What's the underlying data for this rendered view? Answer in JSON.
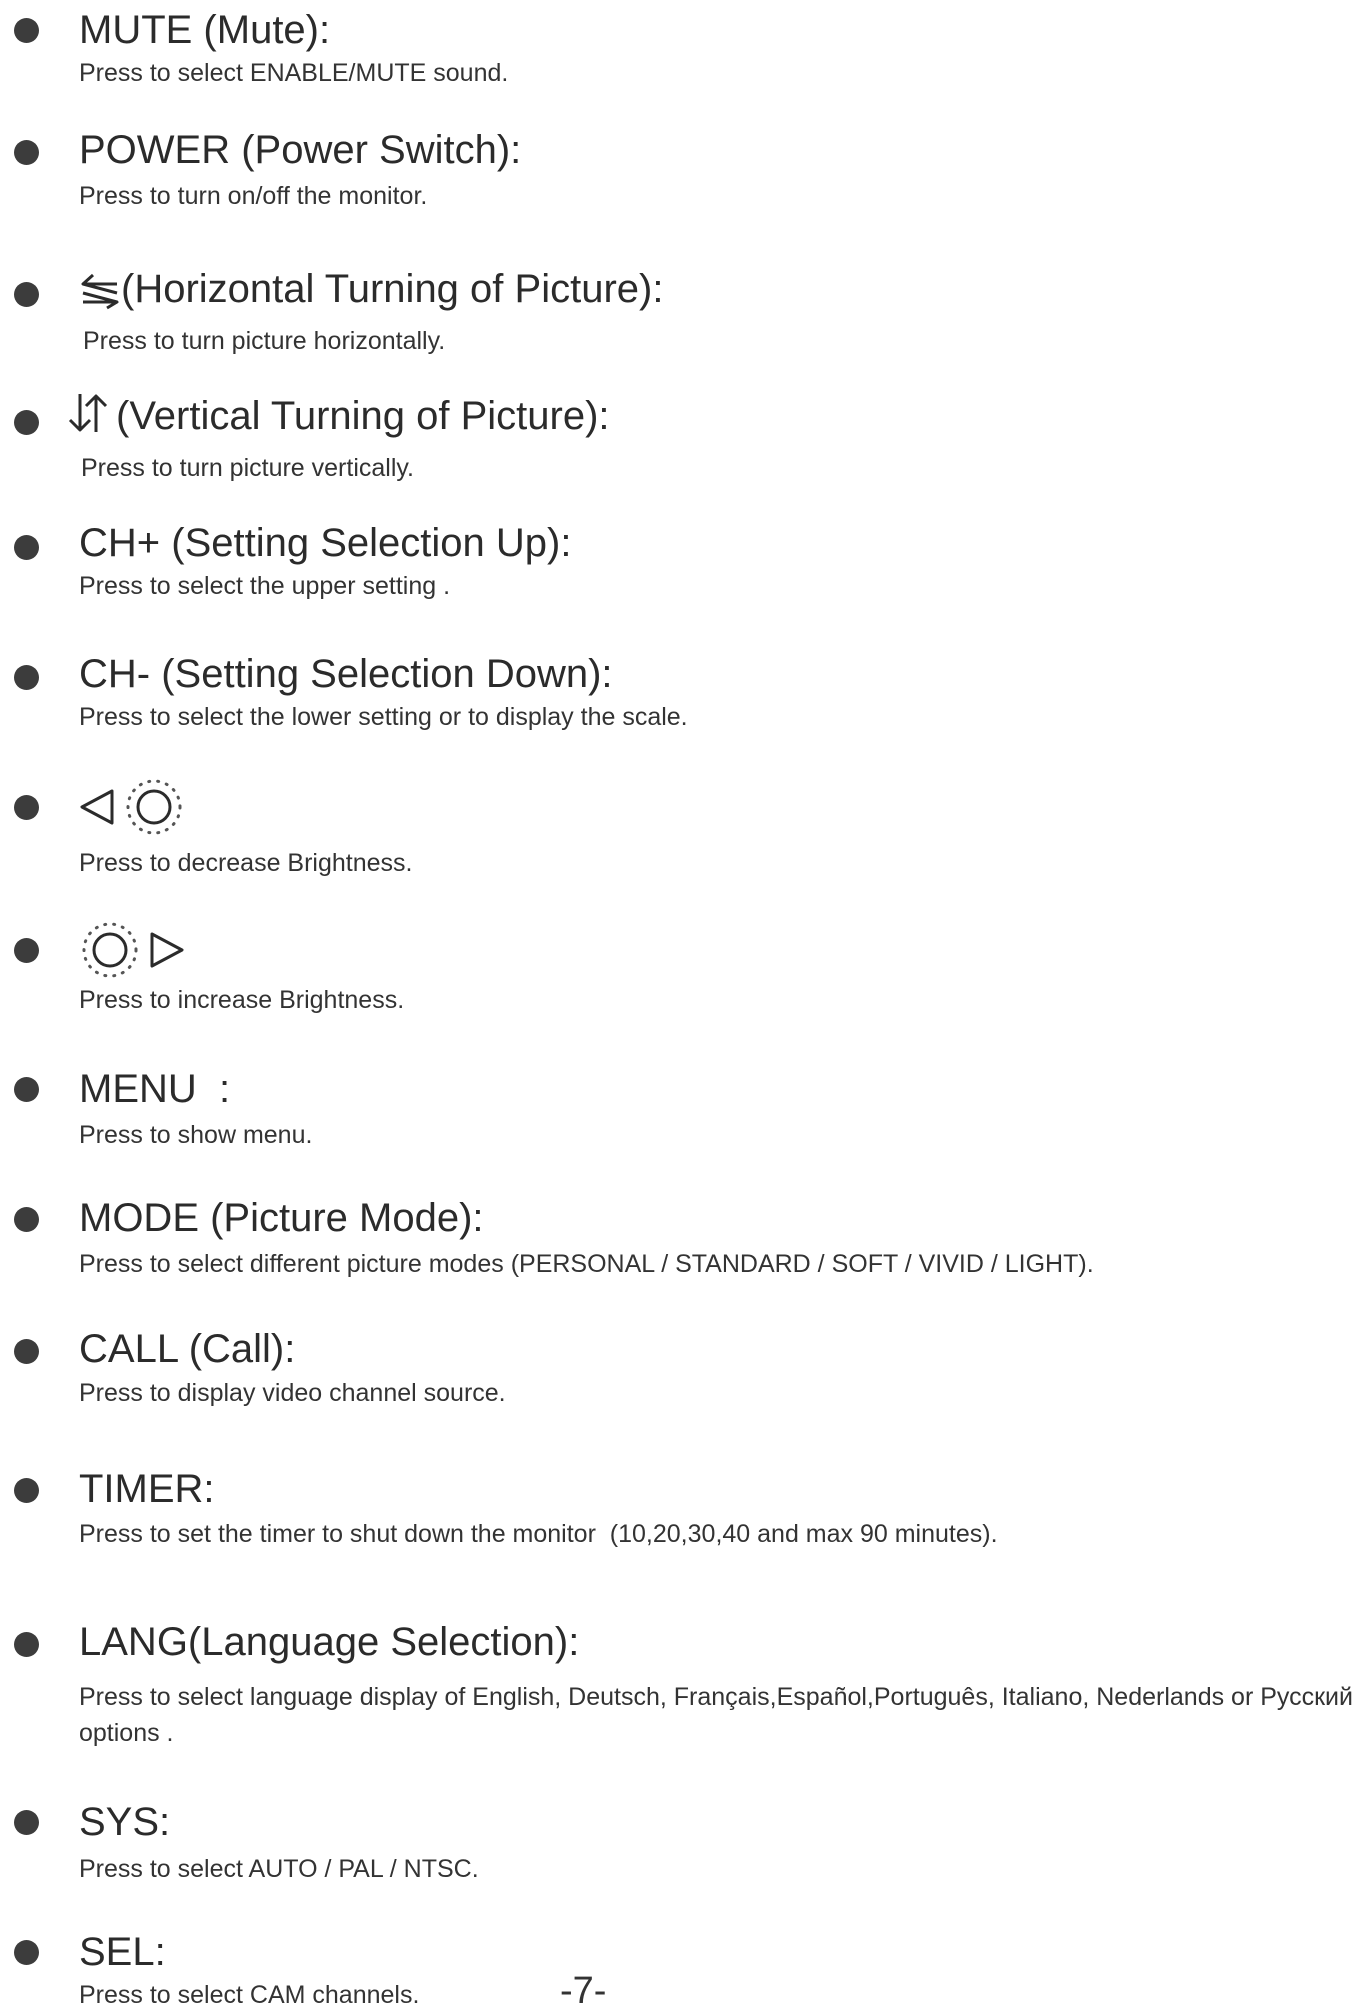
{
  "items": [
    {
      "title": "MUTE (Mute):",
      "desc": "Press to select  ENABLE/MUTE sound."
    },
    {
      "title": "POWER (Power Switch):",
      "desc": "Press to turn on/off the monitor."
    },
    {
      "title": "(Horizontal Turning of Picture):",
      "desc": "Press  to turn picture horizontally.",
      "icon": "horizontal-flip-icon"
    },
    {
      "title": "(Vertical  Turning of Picture):",
      "desc": "Press to turn picture vertically.",
      "icon": "vertical-flip-icon"
    },
    {
      "title": "CH+ (Setting Selection Up):",
      "desc": "Press to select the upper setting ."
    },
    {
      "title": "CH- (Setting Selection Down):",
      "desc": "Press to select the lower setting or to display the scale."
    },
    {
      "desc": "Press to decrease Brightness.",
      "icon": "brightness-decrease-icon"
    },
    {
      "desc": "Press to increase Brightness.",
      "icon": "brightness-increase-icon"
    },
    {
      "title": "MENU  :",
      "desc": "Press to show menu."
    },
    {
      "title": "MODE (Picture Mode):",
      "desc": "Press to select different picture modes (PERSONAL / STANDARD / SOFT / VIVID / LIGHT)."
    },
    {
      "title": "CALL (Call):",
      "desc": "Press to display video channel source."
    },
    {
      "title": "TIMER:",
      "desc": "Press to set the timer to shut down the monitor  (10,20,30,40 and max 90 minutes)."
    },
    {
      "title": "LANG(Language Selection):",
      "desc": "Press to select language display of  English, Deutsch, Français,Español,Português, Italiano,  Nederlands or Русский  options ."
    },
    {
      "title": "SYS:",
      "desc": "Press to select AUTO / PAL / NTSC."
    },
    {
      "title": "SEL:",
      "desc": "Press to select CAM channels."
    }
  ],
  "page_number": "-7-"
}
